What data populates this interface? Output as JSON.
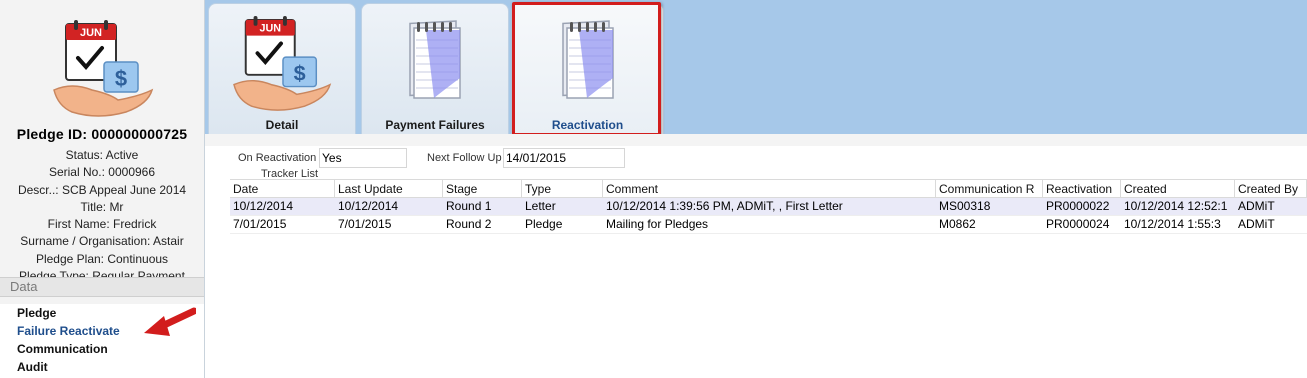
{
  "sidebar": {
    "pledge_id": "Pledge ID: 000000000725",
    "info": [
      "Status: Active",
      "Serial No.: 0000966",
      "Descr..: SCB Appeal June 2014",
      "Title: Mr",
      "First Name: Fredrick",
      "Surname / Organisation: Astair",
      "Pledge Plan: Continuous",
      "Pledge Type: Regular Payment"
    ],
    "section_header": "Data",
    "links": [
      "Pledge",
      "Failure Reactivate",
      "Communication",
      "Audit"
    ],
    "calendar_month": "JUN",
    "icon": "calendar-pledge-icon"
  },
  "tabs": [
    {
      "label": "Detail",
      "icon": "calendar-pledge-icon"
    },
    {
      "label": "Payment Failures",
      "icon": "notepad-icon"
    },
    {
      "label": "Reactivation",
      "icon": "notepad-icon"
    }
  ],
  "form": {
    "on_reactivation_label": "On Reactivation",
    "on_reactivation_value": "Yes",
    "next_follow_up_label": "Next Follow Up",
    "next_follow_up_value": "14/01/2015",
    "tracker_list_label": "Tracker List"
  },
  "grid": {
    "columns": [
      "Date",
      "Last Update",
      "Stage",
      "Type",
      "Comment",
      "Communication R",
      "Reactivation",
      "Created",
      "Created By"
    ],
    "rows": [
      [
        "10/12/2014",
        "10/12/2014",
        "Round 1",
        "Letter",
        "10/12/2014 1:39:56 PM, ADMiT, , First Letter",
        "MS00318",
        "PR0000022",
        "10/12/2014 12:52:1",
        "ADMiT"
      ],
      [
        "7/01/2015",
        "7/01/2015",
        "Round 2",
        "Pledge",
        "Mailing for Pledges",
        "M0862",
        "PR0000024",
        "10/12/2014 1:55:3",
        "ADMiT"
      ]
    ]
  },
  "colors": {
    "tab_strip": "#a6c8e9",
    "highlight": "#d21d1d",
    "active_link": "#1f4e8c",
    "selected_row": "#eaeaf8"
  }
}
